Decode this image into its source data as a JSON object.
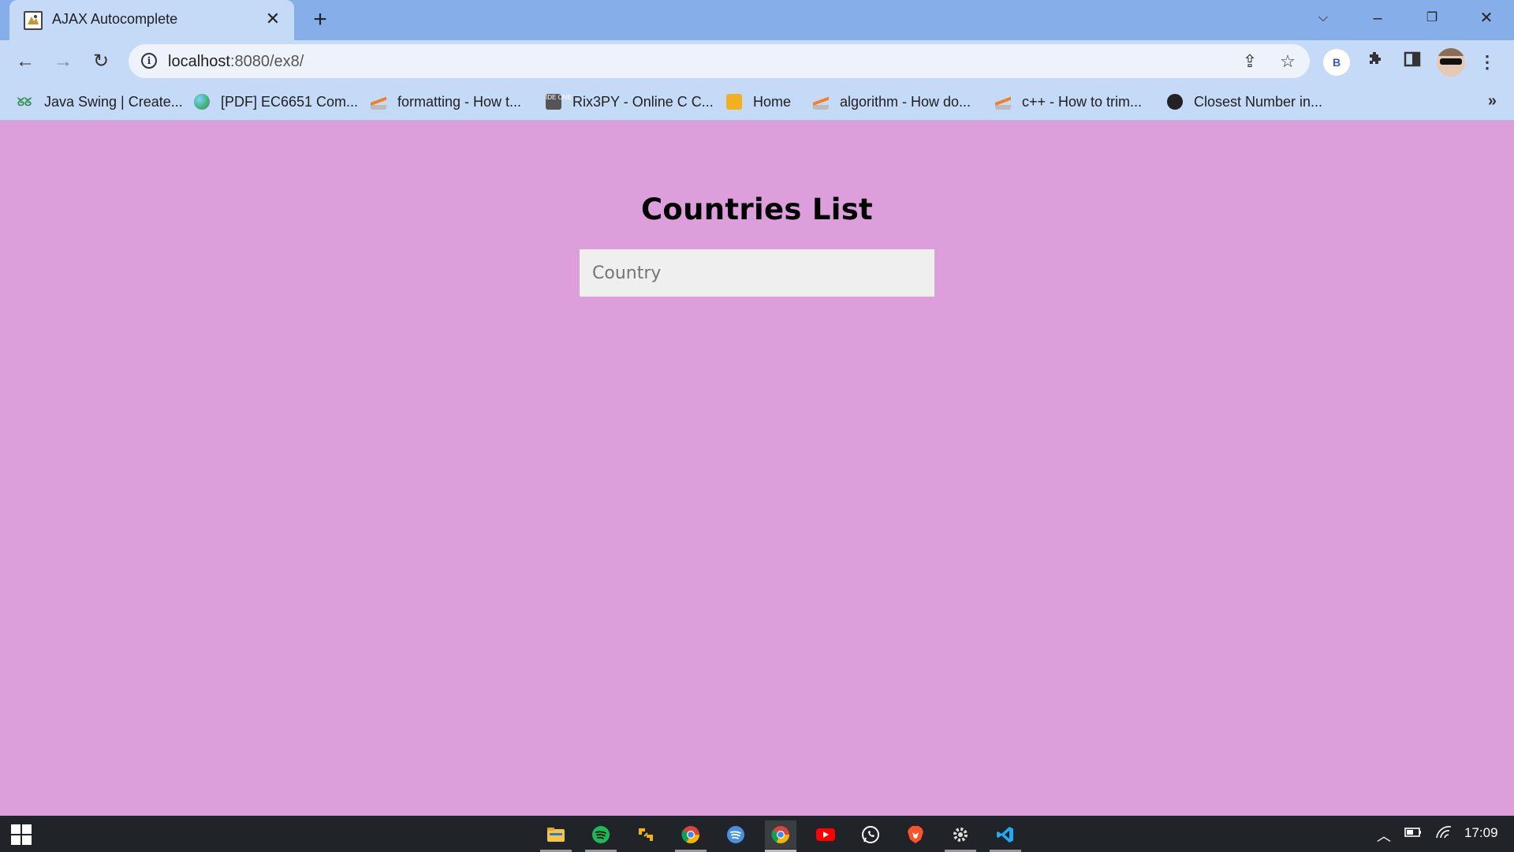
{
  "browser": {
    "tab": {
      "title": "AJAX Autocomplete",
      "favicon": "ajax-favicon-icon"
    },
    "url": {
      "host": "localhost",
      "path": ":8080/ex8/"
    },
    "profile_badge": "B",
    "bookmarks": [
      {
        "label": "Java Swing | Create...",
        "icon": "geeksforgeeks-icon",
        "color": "#2f8d46"
      },
      {
        "label": "[PDF] EC6651 Com...",
        "icon": "globe-colorful-icon",
        "color": "#3cb371"
      },
      {
        "label": "formatting - How t...",
        "icon": "stackoverflow-icon",
        "color": "#f48024"
      },
      {
        "label": "Rix3PY - Online C C...",
        "icon": "ideone-icon",
        "color": "#555555"
      },
      {
        "label": "Home",
        "icon": "box-icon",
        "color": "#f2b01e"
      },
      {
        "label": "algorithm - How do...",
        "icon": "stackoverflow-icon",
        "color": "#f48024"
      },
      {
        "label": "c++ - How to trim...",
        "icon": "stackoverflow-icon",
        "color": "#f48024"
      },
      {
        "label": "Closest Number in...",
        "icon": "globe-dark-icon",
        "color": "#222222"
      }
    ]
  },
  "page": {
    "title": "Countries List",
    "input": {
      "placeholder": "Country",
      "value": ""
    },
    "background": "#dd9fdc"
  },
  "taskbar": {
    "apps": [
      {
        "name": "file-explorer-icon",
        "color": "#f6c544"
      },
      {
        "name": "spotify-icon",
        "color": "#1db954"
      },
      {
        "name": "tool-app-icon",
        "color": "#f2b01e"
      },
      {
        "name": "chrome-icon",
        "color": "#4285f4"
      },
      {
        "name": "spotify-blue-icon",
        "color": "#4a90e2"
      },
      {
        "name": "chrome-active-icon",
        "color": "#4285f4"
      },
      {
        "name": "youtube-icon",
        "color": "#ff0000"
      },
      {
        "name": "whatsapp-icon",
        "color": "#25d366"
      },
      {
        "name": "brave-icon",
        "color": "#fb542b"
      },
      {
        "name": "settings-icon",
        "color": "#dddddd"
      },
      {
        "name": "vscode-icon",
        "color": "#23a9f2"
      }
    ],
    "clock": "17:09"
  }
}
